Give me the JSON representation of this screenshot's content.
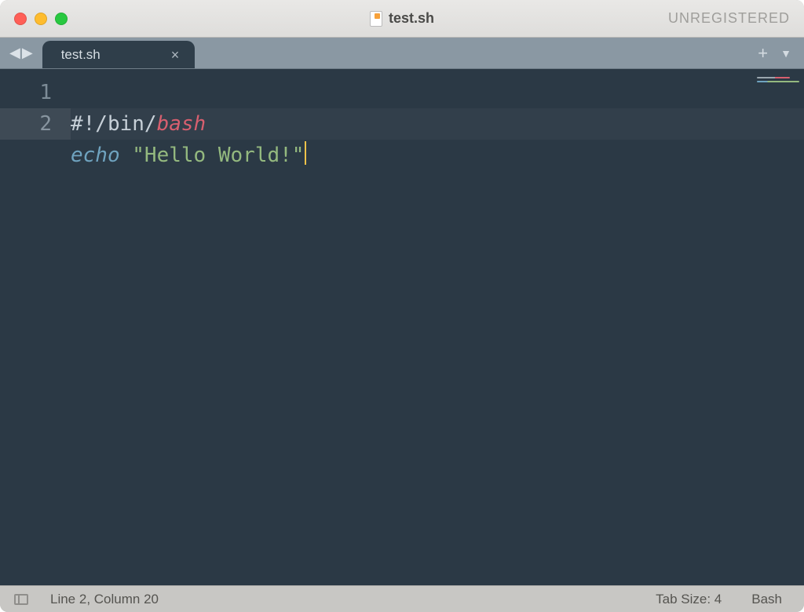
{
  "titlebar": {
    "filename": "test.sh",
    "registration": "UNREGISTERED"
  },
  "tabbar": {
    "tab_label": "test.sh",
    "close_glyph": "×",
    "nav_prev": "◀",
    "nav_next": "▶",
    "plus": "+",
    "dropdown": "▼"
  },
  "editor": {
    "line_numbers": [
      "1",
      "2"
    ],
    "line1": {
      "shebang": "#!/bin/",
      "interp": "bash"
    },
    "line2": {
      "cmd": "echo",
      "space": " ",
      "string": "\"Hello World!\""
    },
    "cursor_line": 2
  },
  "statusbar": {
    "position": "Line 2, Column 20",
    "tab_size": "Tab Size: 4",
    "syntax": "Bash"
  }
}
